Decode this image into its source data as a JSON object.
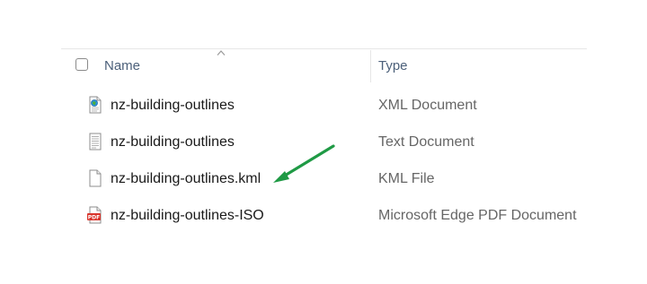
{
  "colors": {
    "header_text": "#4c607a",
    "name_text": "#1a1a1a",
    "type_text": "#666666",
    "arrow": "#1f9a45",
    "pdf_red": "#d9342b"
  },
  "header": {
    "name_label": "Name",
    "type_label": "Type",
    "sort_icon": "sort-ascending-caret-icon"
  },
  "files": [
    {
      "name": "nz-building-outlines",
      "type": "XML Document",
      "icon": "xml-document-icon"
    },
    {
      "name": "nz-building-outlines",
      "type": "Text Document",
      "icon": "text-document-icon"
    },
    {
      "name": "nz-building-outlines.kml",
      "type": "KML File",
      "icon": "blank-file-icon"
    },
    {
      "name": "nz-building-outlines-ISO",
      "type": "Microsoft Edge PDF Document",
      "icon": "pdf-document-icon"
    }
  ],
  "annotation": {
    "icon": "green-arrow-icon",
    "points_to": "nz-building-outlines.kml"
  }
}
